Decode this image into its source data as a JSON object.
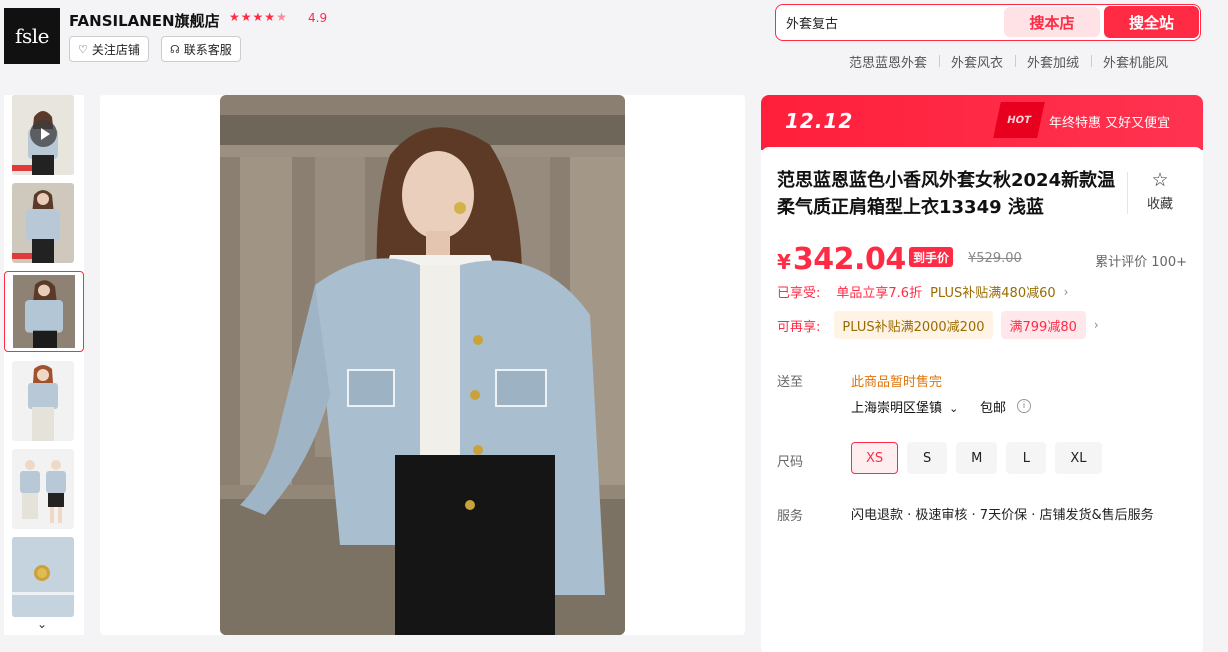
{
  "shop": {
    "logo_text": "fsle",
    "name": "FANSILANEN旗舰店",
    "rating": "4.9",
    "follow_label": "关注店铺",
    "service_label": "联系客服"
  },
  "search": {
    "value": "外套复古",
    "btn_shop": "搜本店",
    "btn_all": "搜全站",
    "hot_words": [
      "范思蓝恩外套",
      "外套风衣",
      "外套加绒",
      "外套机能风"
    ]
  },
  "promo": {
    "event": "12.12",
    "hot": "HOT",
    "text": "年终特惠 又好又便宜"
  },
  "product": {
    "title": "范思蓝恩蓝色小香风外套女秋2024新款温柔气质正肩箱型上衣13349 浅蓝",
    "fav_label": "收藏",
    "price_symbol": "¥",
    "price": "342.04",
    "price_tag": "到手价",
    "original_price": "¥529.00",
    "reviews": "累计评价 100+",
    "enjoyed_label": "已享受:",
    "enjoyed_1": "单品立享7.6折",
    "enjoyed_2": "PLUS补贴满480减60",
    "more_label": "可再享:",
    "coupon_plus": "PLUS补贴满2000减200",
    "coupon_full": "满799减80"
  },
  "delivery": {
    "label": "送至",
    "status": "此商品暂时售完",
    "location": "上海崇明区堡镇",
    "shipping": "包邮"
  },
  "size": {
    "label": "尺码",
    "options": [
      "XS",
      "S",
      "M",
      "L",
      "XL"
    ],
    "selected": "XS"
  },
  "service": {
    "label": "服务",
    "text": "闪电退款 · 极速审核 · 7天价保 · 店铺发货&售后服务"
  },
  "colors": {
    "accent": "#ff2b45",
    "jacket": "#a9bfd0",
    "stone": "#8a7f70"
  }
}
